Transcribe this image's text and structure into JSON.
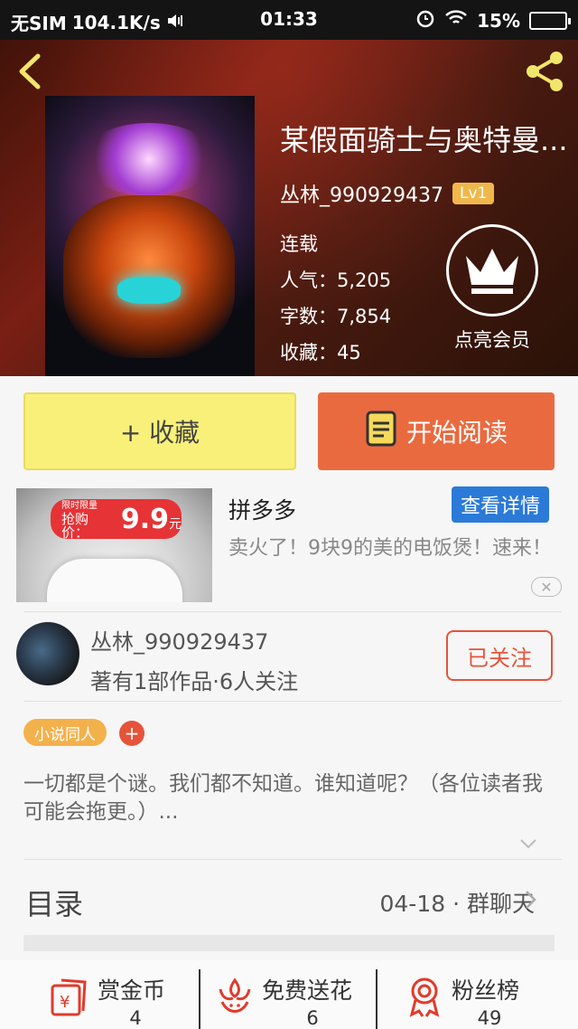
{
  "status_bar": {
    "carrier": "无SIM",
    "speed": "104.1K/s",
    "time": "01:33",
    "battery": "15%"
  },
  "book": {
    "title": "某假面骑士与奥特曼...",
    "author": "丛林_990929437",
    "level": "Lv1",
    "status": "连载",
    "popularity": "人气：5,205",
    "word_count": "字数：7,854",
    "favorites": "收藏：45",
    "vip_label": "点亮会员"
  },
  "actions": {
    "favorite_label": "+ 收藏",
    "read_label": "开始阅读"
  },
  "ad": {
    "badge_small": "限时限量",
    "badge_prefix": "抢购价：",
    "badge_price": "9.9",
    "badge_unit": "元",
    "title": "拼多多",
    "details_label": "查看详情",
    "description": "卖火了！9块9的美的电饭煲！速来！"
  },
  "author_card": {
    "name": "丛林_990929437",
    "meta": "著有1部作品·6人关注",
    "follow_label": "已关注"
  },
  "tags": {
    "category": "小说同人",
    "add": "+"
  },
  "intro": "一切都是个谜。我们都不知道。谁知道呢？（各位读者我可能会拖更。）...",
  "toc": {
    "label": "目录",
    "latest": "04-18 · 群聊天"
  },
  "bottom": {
    "items": [
      {
        "label": "赏金币",
        "count": "4",
        "icon": "coin-envelope-icon"
      },
      {
        "label": "免费送花",
        "count": "6",
        "icon": "flower-icon"
      },
      {
        "label": "粉丝榜",
        "count": "49",
        "icon": "ribbon-icon"
      }
    ]
  },
  "colors": {
    "accent_orange": "#ea6a3f",
    "fav_yellow": "#f9f07a",
    "link_blue": "#2b7ad8",
    "badge_gold": "#f0b84a"
  }
}
